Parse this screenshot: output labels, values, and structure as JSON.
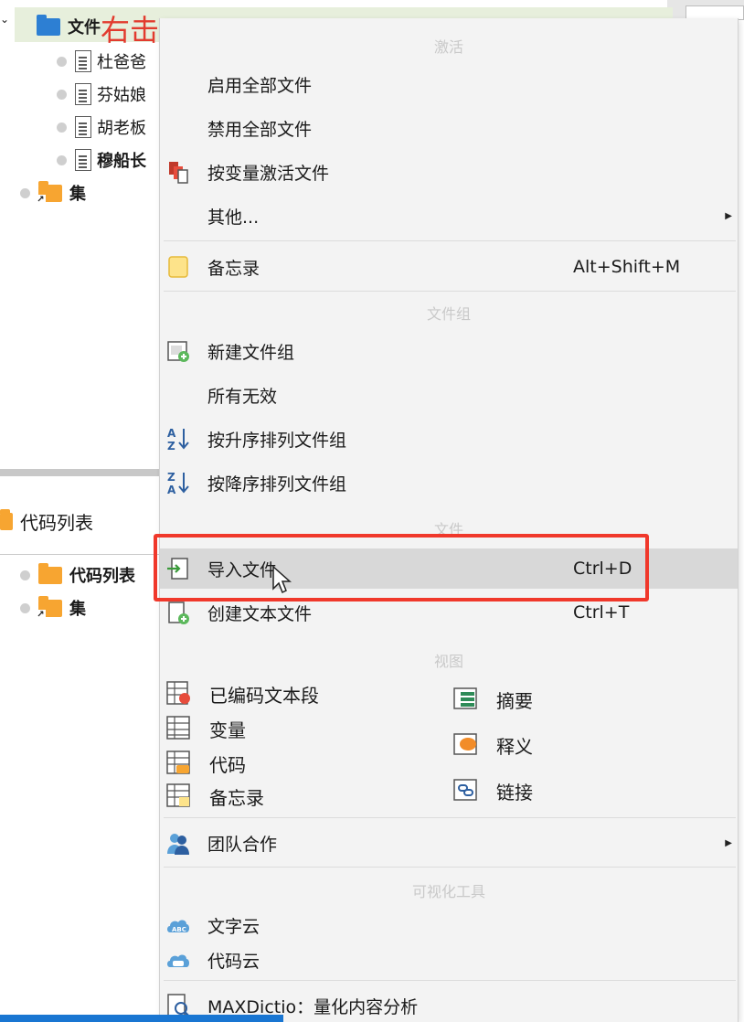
{
  "annotation": "右击",
  "tree": {
    "root_label": "文件",
    "documents": [
      "杜爸爸",
      "芬姑娘",
      "胡老板",
      "穆船长"
    ],
    "set_label": "集",
    "codes_header": "代码列表",
    "codes_item": "代码列表",
    "codes_set": "集"
  },
  "menu": {
    "sections": {
      "activate": "激活",
      "filegroup": "文件组",
      "file": "文件",
      "view": "视图",
      "viz": "可视化工具"
    },
    "items": {
      "enable_all": "启用全部文件",
      "disable_all": "禁用全部文件",
      "activate_by_var": "按变量激活文件",
      "other": "其他...",
      "memo": "备忘录",
      "memo_shortcut": "Alt+Shift+M",
      "new_group": "新建文件组",
      "all_invalid": "所有无效",
      "sort_asc": "按升序排列文件组",
      "sort_desc": "按降序排列文件组",
      "import_file": "导入文件",
      "import_shortcut": "Ctrl+D",
      "create_text": "创建文本文件",
      "create_shortcut": "Ctrl+T",
      "coded_segments": "已编码文本段",
      "variables": "变量",
      "codes": "代码",
      "memos": "备忘录",
      "summary": "摘要",
      "paraphrase": "释义",
      "links": "链接",
      "teamwork": "团队合作",
      "word_cloud": "文字云",
      "code_cloud": "代码云",
      "maxdictio": "MAXDictio：量化内容分析"
    }
  },
  "colors": {
    "annotation_red": "#e23b2e",
    "highlight_box": "#f0382b",
    "folder_orange": "#f7a531",
    "folder_blue": "#2d7fd3"
  }
}
